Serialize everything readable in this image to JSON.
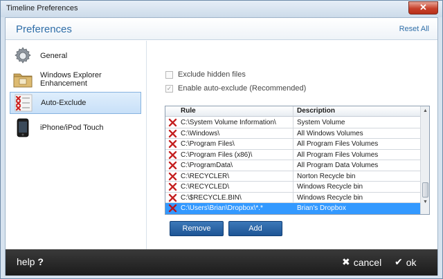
{
  "window": {
    "title": "Timeline Preferences",
    "close_glyph": "✕"
  },
  "header": {
    "title": "Preferences",
    "reset_label": "Reset All"
  },
  "sidebar": {
    "items": [
      {
        "label": "General",
        "icon": "gear-icon"
      },
      {
        "label": "Windows Explorer Enhancement",
        "icon": "folder-icon"
      },
      {
        "label": "Auto-Exclude",
        "icon": "exclude-list-icon",
        "selected": true
      },
      {
        "label": "iPhone/iPod Touch",
        "icon": "phone-icon"
      }
    ]
  },
  "options": {
    "exclude_hidden": {
      "label": "Exclude hidden files",
      "checked": false
    },
    "auto_exclude": {
      "label": "Enable auto-exclude (Recommended)",
      "checked": true,
      "check_glyph": "✓"
    }
  },
  "table": {
    "columns": {
      "rule": "Rule",
      "description": "Description"
    },
    "rows": [
      {
        "rule": "C:\\System Volume Information\\",
        "description": "System Volume"
      },
      {
        "rule": "C:\\Windows\\",
        "description": "All Windows Volumes"
      },
      {
        "rule": "C:\\Program Files\\",
        "description": "All Program Files Volumes"
      },
      {
        "rule": "C:\\Program Files (x86)\\",
        "description": "All Program Files Volumes"
      },
      {
        "rule": "C:\\ProgramData\\",
        "description": "All Program Data Volumes"
      },
      {
        "rule": "C:\\RECYCLER\\",
        "description": "Norton Recycle bin"
      },
      {
        "rule": "C:\\RECYCLED\\",
        "description": "Windows Recycle bin"
      },
      {
        "rule": "C:\\$RECYCLE.BIN\\",
        "description": "Windows Recycle bin"
      },
      {
        "rule": "C:\\Users\\Brian\\Dropbox\\*.*",
        "description": "Brian's Dropbox",
        "selected": true
      }
    ],
    "scroll_up": "▲",
    "scroll_down": "▼"
  },
  "buttons": {
    "remove": "Remove",
    "add": "Add"
  },
  "footer": {
    "help_label": "help",
    "help_glyph": "?",
    "cancel_label": "cancel",
    "cancel_glyph": "✖",
    "ok_label": "ok",
    "ok_glyph": "✔"
  },
  "colors": {
    "accent": "#2f6ea8",
    "selection": "#3399ff",
    "button": "#1e5595",
    "footer": "#1b1b1b",
    "close": "#c7412b"
  }
}
